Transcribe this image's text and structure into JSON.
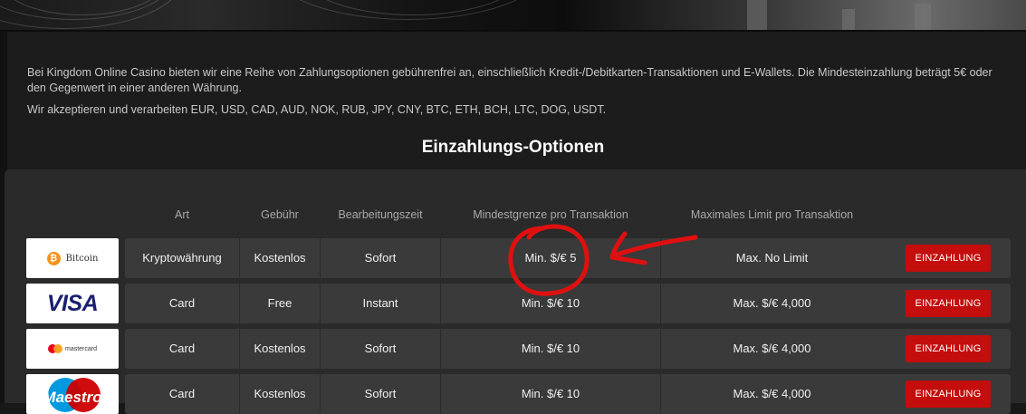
{
  "intro": {
    "paragraph1": "Bei Kingdom Online Casino bieten wir eine Reihe von Zahlungsoptionen gebührenfrei an, einschließlich Kredit-/Debitkarten-Transaktionen und E-Wallets. Die Mindesteinzahlung beträgt 5€ oder den Gegenwert in einer anderen Währung.",
    "paragraph2": "Wir akzeptieren und verarbeiten EUR, USD, CAD, AUD, NOK, RUB, JPY, CNY, BTC, ETH, BCH, LTC, DOG, USDT."
  },
  "section_title": "Einzahlungs-Optionen",
  "table": {
    "headers": {
      "type": "Art",
      "fee": "Gebühr",
      "processing": "Bearbeitungszeit",
      "min": "Mindestgrenze pro Transaktion",
      "max": "Maximales Limit pro Transaktion"
    },
    "rows": [
      {
        "method": "Bitcoin",
        "logo_icon": "bitcoin-logo",
        "type": "Kryptowährung",
        "fee": "Kostenlos",
        "processing": "Sofort",
        "min": "Min. $/€ 5",
        "max": "Max. No Limit",
        "button": "EINZAHLUNG"
      },
      {
        "method": "VISA",
        "logo_icon": "visa-logo",
        "type": "Card",
        "fee": "Free",
        "processing": "Instant",
        "min": "Min. $/€ 10",
        "max": "Max. $/€ 4,000",
        "button": "EINZAHLUNG"
      },
      {
        "method": "mastercard",
        "logo_icon": "mastercard-logo",
        "type": "Card",
        "fee": "Kostenlos",
        "processing": "Sofort",
        "min": "Min. $/€ 10",
        "max": "Max. $/€ 4,000",
        "button": "EINZAHLUNG"
      },
      {
        "method": "Maestro",
        "logo_icon": "maestro-logo",
        "type": "Card",
        "fee": "Kostenlos",
        "processing": "Sofort",
        "min": "Min. $/€ 10",
        "max": "Max. $/€ 4,000",
        "button": "EINZAHLUNG"
      }
    ]
  },
  "colors": {
    "button": "#c40d0d",
    "annotation": "#e01010",
    "row_bg": "#3a3a3a",
    "panel_bg": "#2a2a2a"
  }
}
